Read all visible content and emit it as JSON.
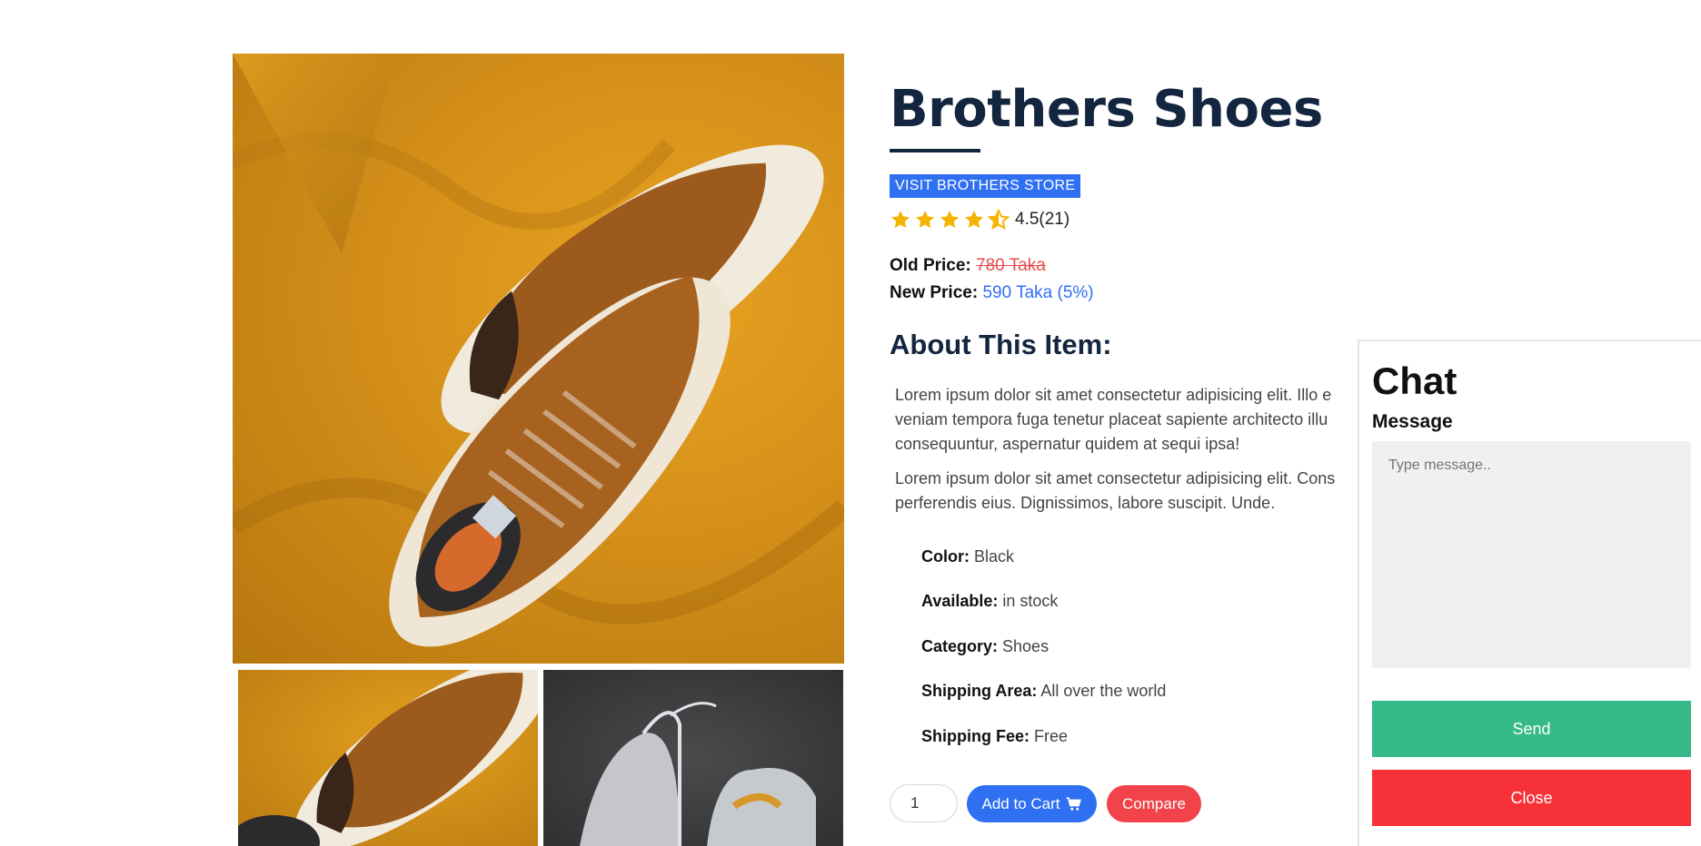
{
  "product": {
    "title": "Brothers Shoes",
    "store_link": "VISIT BROTHERS STORE",
    "rating_text": "4.5(21)",
    "rating_value": 4.5,
    "rating_max": 5,
    "old_price_label": "Old Price:",
    "old_price_value": "780 Taka",
    "new_price_label": "New Price:",
    "new_price_value": "590 Taka (5%)",
    "about_heading": "About This Item:",
    "paragraph1_lines": [
      "Lorem ipsum dolor sit amet consectetur adipisicing elit. Illo e",
      "veniam tempora fuga tenetur placeat sapiente architecto illu",
      "consequuntur, aspernatur quidem at sequi ipsa!"
    ],
    "paragraph2_lines": [
      "Lorem ipsum dolor sit amet consectetur adipisicing elit. Cons",
      "perferendis eius. Dignissimos, labore suscipit. Unde."
    ],
    "specs": [
      {
        "label": "Color:",
        "value": "Black"
      },
      {
        "label": "Available:",
        "value": "in stock"
      },
      {
        "label": "Category:",
        "value": "Shoes"
      },
      {
        "label": "Shipping Area:",
        "value": "All over the world"
      },
      {
        "label": "Shipping Fee:",
        "value": "Free"
      }
    ],
    "quantity": "1",
    "add_to_cart_label": "Add to Cart",
    "compare_label": "Compare"
  },
  "chat": {
    "title": "Chat",
    "message_label": "Message",
    "message_placeholder": "Type message..",
    "send_label": "Send",
    "close_label": "Close"
  },
  "colors": {
    "title": "#14263f",
    "accent_blue": "#2f6ff2",
    "star": "#f4b400",
    "old_price": "#e84b4b",
    "send_green": "#35b987",
    "close_red": "#f63138",
    "compare_red": "#f2434a"
  },
  "icons": [
    "star-icon",
    "half-star-icon",
    "cart-icon"
  ]
}
